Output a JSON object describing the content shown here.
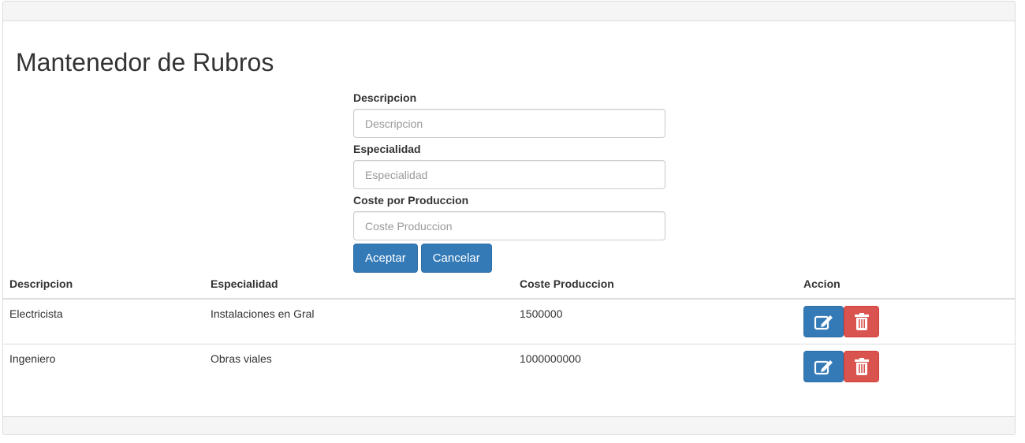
{
  "page": {
    "title": "Mantenedor de Rubros"
  },
  "form": {
    "descripcion_label": "Descripcion",
    "descripcion_placeholder": "Descripcion",
    "especialidad_label": "Especialidad",
    "especialidad_placeholder": "Especialidad",
    "coste_label": "Coste por Produccion",
    "coste_placeholder": "Coste Produccion",
    "aceptar_label": "Aceptar",
    "cancelar_label": "Cancelar"
  },
  "table": {
    "headers": [
      "Descripcion",
      "Especialidad",
      "Coste Produccion",
      "Accion"
    ],
    "rows": [
      {
        "descripcion": "Electricista",
        "especialidad": "Instalaciones en Gral",
        "coste": "1500000",
        "edit_icon": "edit-icon",
        "delete_icon": "trash-icon"
      },
      {
        "descripcion": "Ingeniero",
        "especialidad": "Obras viales",
        "coste": "1000000000",
        "edit_icon": "edit-icon",
        "delete_icon": "trash-icon"
      }
    ]
  },
  "colors": {
    "primary": "#337ab7",
    "danger": "#d9534f"
  }
}
